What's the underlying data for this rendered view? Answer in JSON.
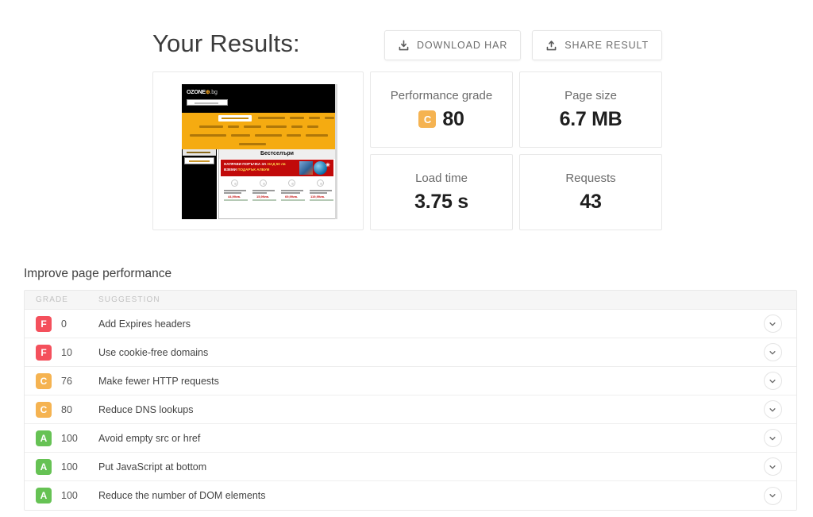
{
  "header": {
    "title": "Your Results:",
    "buttons": [
      {
        "label": "DOWNLOAD HAR",
        "icon": "download-icon"
      },
      {
        "label": "SHARE RESULT",
        "icon": "share-icon"
      }
    ]
  },
  "thumbnail": {
    "site_logo": "OZONE",
    "site_logo_suffix": ".bg",
    "section_title": "Бестселъри",
    "promo_line1_a": "НАПРАВИ ПОРЪЧКА ЗА ",
    "promo_line1_b": "НАД 50 лв",
    "promo_line2_a": "ВЗЕМИ ",
    "promo_line2_b": "ПОДАРЪК АЛБУМ",
    "prices": [
      "44,99лв.",
      "15,99лв.",
      "69,99лв.",
      "119,99лв."
    ]
  },
  "metrics": [
    {
      "label": "Performance grade",
      "value": "80",
      "grade": "C",
      "grade_color": "#f5b351"
    },
    {
      "label": "Page size",
      "value": "6.7 MB",
      "grade": null,
      "grade_color": null
    },
    {
      "label": "Load time",
      "value": "3.75 s",
      "grade": null,
      "grade_color": null
    },
    {
      "label": "Requests",
      "value": "43",
      "grade": null,
      "grade_color": null
    }
  ],
  "improve": {
    "title": "Improve page performance",
    "columns": {
      "grade": "GRADE",
      "suggestion": "SUGGESTION"
    },
    "expand_icon": "chevron-down-icon",
    "rows": [
      {
        "grade": "F",
        "color": "#f4505c",
        "score": "0",
        "suggestion": "Add Expires headers"
      },
      {
        "grade": "F",
        "color": "#f4505c",
        "score": "10",
        "suggestion": "Use cookie-free domains"
      },
      {
        "grade": "C",
        "color": "#f5b351",
        "score": "76",
        "suggestion": "Make fewer HTTP requests"
      },
      {
        "grade": "C",
        "color": "#f5b351",
        "score": "80",
        "suggestion": "Reduce DNS lookups"
      },
      {
        "grade": "A",
        "color": "#66c council",
        "score": "100",
        "suggestion": "Avoid empty src or href"
      },
      {
        "grade": "A",
        "color": "#66c254",
        "score": "100",
        "suggestion": "Put JavaScript at bottom"
      },
      {
        "grade": "A",
        "color": "#66c254",
        "score": "100",
        "suggestion": "Reduce the number of DOM elements"
      }
    ]
  },
  "colors": {
    "page_bg": "#ffffff",
    "card_border": "#e8e8e8",
    "grade_a": "#66c254",
    "grade_c": "#f5b351",
    "grade_f": "#f4505c",
    "text_primary": "#3c3c3c",
    "text_muted": "#6b6b6b"
  }
}
